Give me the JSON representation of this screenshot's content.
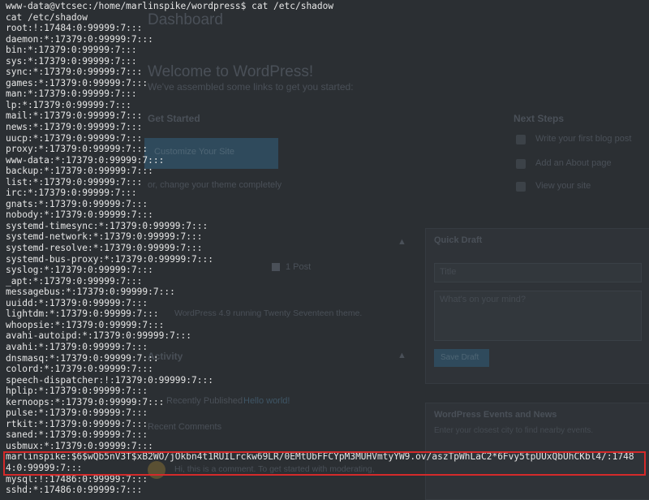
{
  "dashboard_bg": {
    "title": "Dashboard",
    "welcome": "Welcome to WordPress!",
    "welcome_sub": "We've assembled some links to get you started:",
    "get_started": "Get Started",
    "customize_button": "Customize Your Site",
    "or_change": "or, change your theme completely",
    "next_steps": "Next Steps",
    "next_steps_items": [
      "Write your first blog post",
      "Add an About page",
      "View your site"
    ],
    "quick_draft": "Quick Draft",
    "quick_draft_title_placeholder": "Title",
    "quick_draft_body_placeholder": "What's on your mind?",
    "save_draft": "Save Draft",
    "events_title": "WordPress Events and News",
    "events_sub": "Enter your closest city to find nearby events.",
    "post_link": "1 Post",
    "theme_line": "WordPress 4.9 running Twenty Seventeen theme.",
    "activity_section": "Activity",
    "recently_published": "Recently Published",
    "recent_link": "Hello world!",
    "recent_comments": "Recent Comments",
    "comment_text": "Hi, this is a comment. To get started with moderating,"
  },
  "terminal": {
    "prompt": "www-data@vtcsec:/home/marlinspike/wordpress$ cat /etc/shadow",
    "command_echo": "cat /etc/shadow",
    "lines": [
      "root:!:17484:0:99999:7:::",
      "daemon:*:17379:0:99999:7:::",
      "bin:*:17379:0:99999:7:::",
      "sys:*:17379:0:99999:7:::",
      "sync:*:17379:0:99999:7:::",
      "games:*:17379:0:99999:7:::",
      "man:*:17379:0:99999:7:::",
      "lp:*:17379:0:99999:7:::",
      "mail:*:17379:0:99999:7:::",
      "news:*:17379:0:99999:7:::",
      "uucp:*:17379:0:99999:7:::",
      "proxy:*:17379:0:99999:7:::",
      "www-data:*:17379:0:99999:7:::",
      "backup:*:17379:0:99999:7:::",
      "list:*:17379:0:99999:7:::",
      "irc:*:17379:0:99999:7:::",
      "gnats:*:17379:0:99999:7:::",
      "nobody:*:17379:0:99999:7:::",
      "systemd-timesync:*:17379:0:99999:7:::",
      "systemd-network:*:17379:0:99999:7:::",
      "systemd-resolve:*:17379:0:99999:7:::",
      "systemd-bus-proxy:*:17379:0:99999:7:::",
      "syslog:*:17379:0:99999:7:::",
      "_apt:*:17379:0:99999:7:::",
      "messagebus:*:17379:0:99999:7:::",
      "uuidd:*:17379:0:99999:7:::",
      "lightdm:*:17379:0:99999:7:::",
      "whoopsie:*:17379:0:99999:7:::",
      "avahi-autoipd:*:17379:0:99999:7:::",
      "avahi:*:17379:0:99999:7:::",
      "dnsmasq:*:17379:0:99999:7:::",
      "colord:*:17379:0:99999:7:::",
      "speech-dispatcher:!:17379:0:99999:7:::",
      "hplip:*:17379:0:99999:7:::",
      "kernoops:*:17379:0:99999:7:::",
      "pulse:*:17379:0:99999:7:::",
      "rtkit:*:17379:0:99999:7:::",
      "saned:*:17379:0:99999:7:::",
      "usbmux:*:17379:0:99999:7:::"
    ],
    "highlighted_line_1": "marlinspike:$6$wQb5nV3T$xB2WO/jOkbn4t1RUILrckw69LR/0EMtUbFFCYpM3MUHVmtyYW9.ov/aszTpWhLaC2*6Fvy5tpUUxQbUhCKbl4/:1748",
    "highlighted_line_2": "4:0:99999:7:::",
    "after_lines": [
      "mysql:!:17486:0:99999:7:::",
      "sshd:*:17486:0:99999:7:::"
    ],
    "highlight_color": "#d42a2a"
  }
}
